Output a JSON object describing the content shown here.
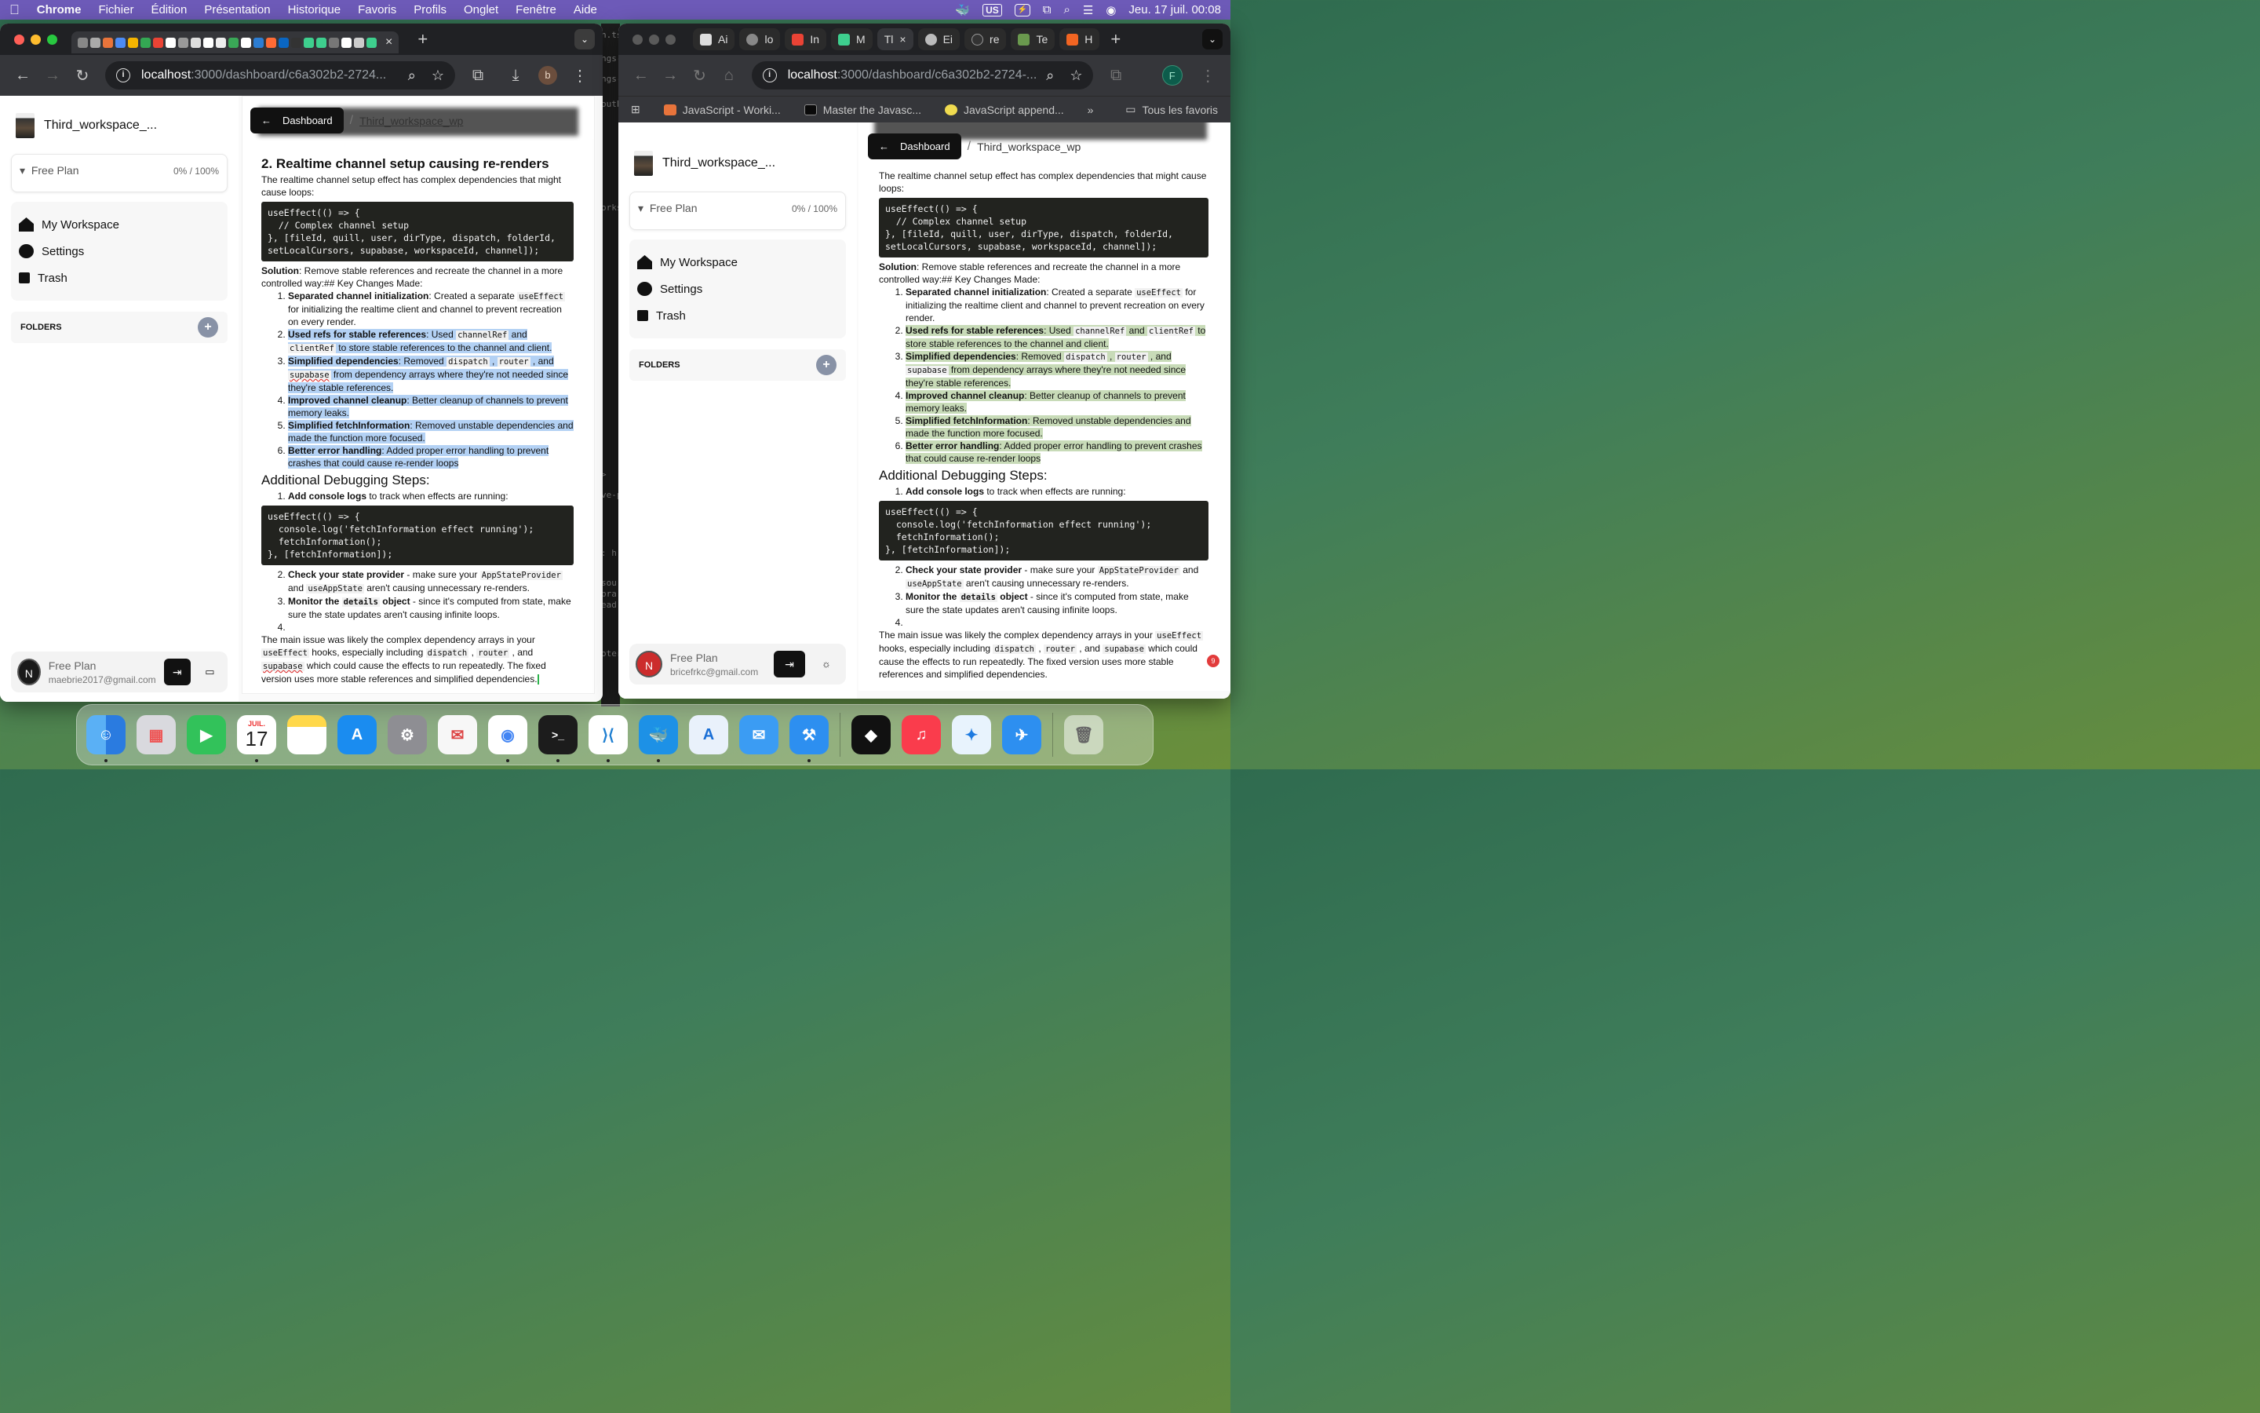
{
  "menubar": {
    "app": "Chrome",
    "items": [
      "Fichier",
      "Édition",
      "Présentation",
      "Historique",
      "Favoris",
      "Profils",
      "Onglet",
      "Fenêtre",
      "Aide"
    ],
    "keyboard": "US",
    "clock": "Jeu. 17 juil.  00:08"
  },
  "left_window": {
    "url_host": "localhost",
    "url_path": ":3000/dashboard/c6a302b2-2724...",
    "profile_initial": "b",
    "tab_close": "×",
    "new_tab": "+",
    "workspace_name": "Third_workspace_...",
    "plan_label": "Free Plan",
    "plan_usage": "0% / 100%",
    "nav": [
      "My Workspace",
      "Settings",
      "Trash"
    ],
    "folders_label": "FOLDERS",
    "footer_plan": "Free Plan",
    "footer_email": "maebrie2017@gmail.com",
    "footer_initial": "N",
    "breadcrumb_button": "Dashboard",
    "breadcrumb_sep": "/",
    "breadcrumb_workspace": "Third_workspace_wp"
  },
  "right_window": {
    "tabs": [
      "Ai",
      "lo",
      "In",
      "M",
      "Tl",
      "Ei",
      "re",
      "Te",
      "H"
    ],
    "url_host": "localhost",
    "url_path": ":3000/dashboard/c6a302b2-2724-...",
    "profile_initial": "F",
    "bookmarks": [
      "JavaScript - Worki...",
      "Master the Javasc...",
      "JavaScript append..."
    ],
    "bookmarks_more": "»",
    "all_bookmarks": "Tous les favoris",
    "workspace_name": "Third_workspace_...",
    "plan_label": "Free Plan",
    "plan_usage": "0% / 100%",
    "nav": [
      "My Workspace",
      "Settings",
      "Trash"
    ],
    "folders_label": "FOLDERS",
    "footer_plan": "Free Plan",
    "footer_email": "bricefrkc@gmail.com",
    "footer_initial": "N",
    "breadcrumb_button": "Dashboard",
    "breadcrumb_sep": "/",
    "breadcrumb_workspace": "Third_workspace_wp",
    "notif_count": "9"
  },
  "doc": {
    "heading2": "2. Realtime channel setup causing re-renders",
    "intro": "The realtime channel setup effect has complex dependencies that might cause loops:",
    "code1": "useEffect(() => {\n  // Complex channel setup\n}, [fileId, quill, user, dirType, dispatch, folderId,\nsetLocalCursors, supabase, workspaceId, channel]);",
    "solution_label": "Solution",
    "solution_text": ": Remove stable references and recreate the channel in a more controlled way:## Key Changes Made:",
    "changes": [
      {
        "b": "Separated channel initialization",
        "t": ": Created a separate ",
        "c": "useEffect",
        "t2": " for initializing the realtime client and channel to prevent recreation on every render."
      },
      {
        "b": "Used refs for stable references",
        "t": ": Used ",
        "c": "channelRef",
        "t2": " and ",
        "c2": "clientRef",
        "t3": " to store stable references to the channel and client."
      },
      {
        "b": "Simplified dependencies",
        "t": ": Removed ",
        "c": "dispatch",
        "t2": " , ",
        "c2": "router",
        "t3": " , and ",
        "c3": "supabase",
        "t4": " from dependency arrays where they're not needed since they're stable references."
      },
      {
        "b": "Improved channel cleanup",
        "t": ": Better cleanup of channels to prevent memory leaks."
      },
      {
        "b": "Simplified fetchInformation",
        "t": ": Removed unstable dependencies and made the function more focused."
      },
      {
        "b": "Better error handling",
        "t": ": Added proper error handling to prevent crashes that could cause re-render loops"
      }
    ],
    "heading3": "Additional Debugging Steps:",
    "step1_b": "Add console logs",
    "step1_t": " to track when effects are running:",
    "code2": "useEffect(() => {\n  console.log('fetchInformation effect running');\n  fetchInformation();\n}, [fetchInformation]);",
    "step2_b": "Check your state provider",
    "step2_t": " - make sure your ",
    "step2_c": "AppStateProvider",
    "step2_t2": " and ",
    "step2_c2": "useAppState",
    "step2_t3": " aren't causing unnecessary re-renders.",
    "step3_b": "Monitor the ",
    "step3_c": "details",
    "step3_b2": " object",
    "step3_t": " - since it's computed from state, make sure the state updates aren't causing infinite loops.",
    "conclusion_1": "The main issue was likely the complex dependency arrays in your ",
    "conclusion_c1": "useEffect",
    "conclusion_2": " hooks, especially including ",
    "conclusion_c2": "dispatch",
    "conclusion_3": " , ",
    "conclusion_c3": "router",
    "conclusion_4": " , and ",
    "conclusion_c4": "supabase",
    "conclusion_5": " which could cause the effects to run repeatedly. The fixed version uses more stable references and simplified dependencies."
  },
  "dock": {
    "apps": [
      "Finder",
      "Launchpad",
      "FaceTime",
      "Calendar",
      "Notes",
      "App Store",
      "System Settings",
      "Airmail",
      "Chrome",
      "Terminal",
      "VS Code",
      "Docker",
      "Xcode Instruments",
      "Mail",
      "Xcode",
      "Parallels",
      "Music",
      "Safari",
      "Simulator",
      "Trash"
    ],
    "calendar_month": "JUIL.",
    "calendar_day": "17"
  },
  "colors": {
    "menubar": "#6d5ab8",
    "selection_blue": "#b3d1f4",
    "selection_green": "#c8dbb8"
  }
}
